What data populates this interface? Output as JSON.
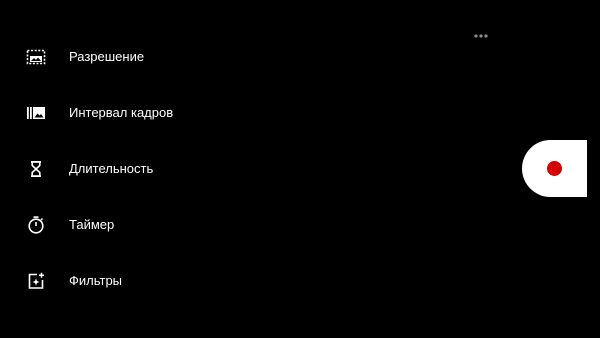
{
  "menu": {
    "items": [
      {
        "label": "Разрешение",
        "icon": "resolution-icon"
      },
      {
        "label": "Интервал кадров",
        "icon": "frame-interval-icon"
      },
      {
        "label": "Длительность",
        "icon": "hourglass-icon"
      },
      {
        "label": "Таймер",
        "icon": "timer-icon"
      },
      {
        "label": "Фильтры",
        "icon": "filters-icon"
      }
    ]
  },
  "overflow_menu": {
    "icon": "more-horizontal-icon"
  },
  "record": {
    "icon": "record-icon"
  },
  "colors": {
    "background": "#000000",
    "text": "#ffffff",
    "record_button_bg": "#ffffff",
    "record_dot": "#d50000",
    "overflow_dots": "#8a8a8a"
  }
}
